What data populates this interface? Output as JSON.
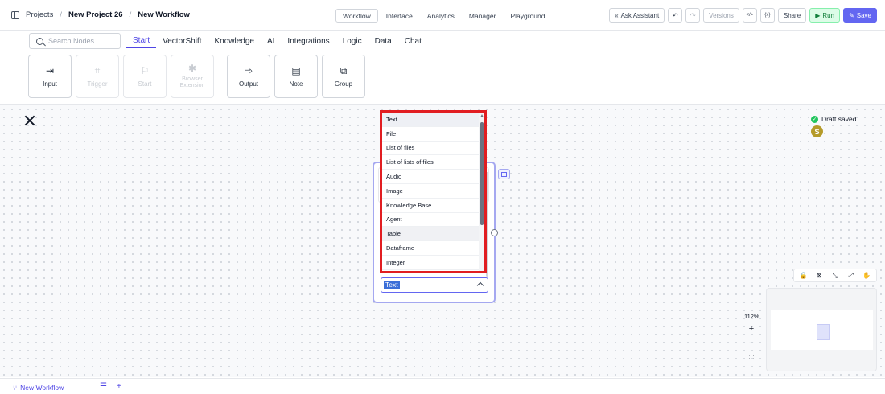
{
  "breadcrumb": {
    "root": "Projects",
    "project": "New Project 26",
    "workflow": "New Workflow",
    "separator": "/"
  },
  "top_tabs": [
    {
      "label": "Workflow",
      "active": true
    },
    {
      "label": "Interface"
    },
    {
      "label": "Analytics"
    },
    {
      "label": "Manager"
    },
    {
      "label": "Playground"
    }
  ],
  "actions": {
    "ask_assistant": "Ask Assistant",
    "undo_icon": "↶",
    "redo_icon": "↷",
    "versions": "Versions",
    "code_icon": "</>",
    "var_icon": "{x}",
    "share": "Share",
    "run": "Run",
    "save": "Save"
  },
  "search": {
    "placeholder": "Search Nodes"
  },
  "categories": [
    "Start",
    "VectorShift",
    "Knowledge",
    "AI",
    "Integrations",
    "Logic",
    "Data",
    "Chat"
  ],
  "tiles": [
    {
      "label": "Input",
      "glyph": "⇥",
      "disabled": false
    },
    {
      "label": "Trigger",
      "glyph": "⌗",
      "disabled": true
    },
    {
      "label": "Start",
      "glyph": "⚐",
      "disabled": true
    },
    {
      "label": "Browser Extension",
      "glyph": "✱",
      "disabled": true
    },
    {
      "label": "Output",
      "glyph": "⇨",
      "disabled": false
    },
    {
      "label": "Note",
      "glyph": "▤",
      "disabled": false
    },
    {
      "label": "Group",
      "glyph": "⧉",
      "disabled": false
    }
  ],
  "status": {
    "draft": "Draft saved",
    "check": "✓",
    "avatar": "S"
  },
  "dropdown": {
    "options": [
      "Text",
      "File",
      "List of files",
      "List of lists of files",
      "Audio",
      "Image",
      "Knowledge Base",
      "Agent",
      "Table",
      "Dataframe",
      "Integer"
    ],
    "selected": "Text",
    "hovered": "Table"
  },
  "select": {
    "value": "Text"
  },
  "controls": {
    "icons": [
      "🔒",
      "⊠",
      "⤡",
      "⤢",
      "✋"
    ],
    "zoom": "112%",
    "zoom_in": "+",
    "zoom_out": "−",
    "fit": "⛶"
  },
  "bottom": {
    "workflow_tab": "New Workflow",
    "branch_icon": "⑂",
    "dots": "⋮",
    "list_icon": "☰",
    "add_icon": "+"
  },
  "colors": {
    "accent": "#6366f1",
    "highlight": "#e11d21",
    "run": "#15803d"
  }
}
